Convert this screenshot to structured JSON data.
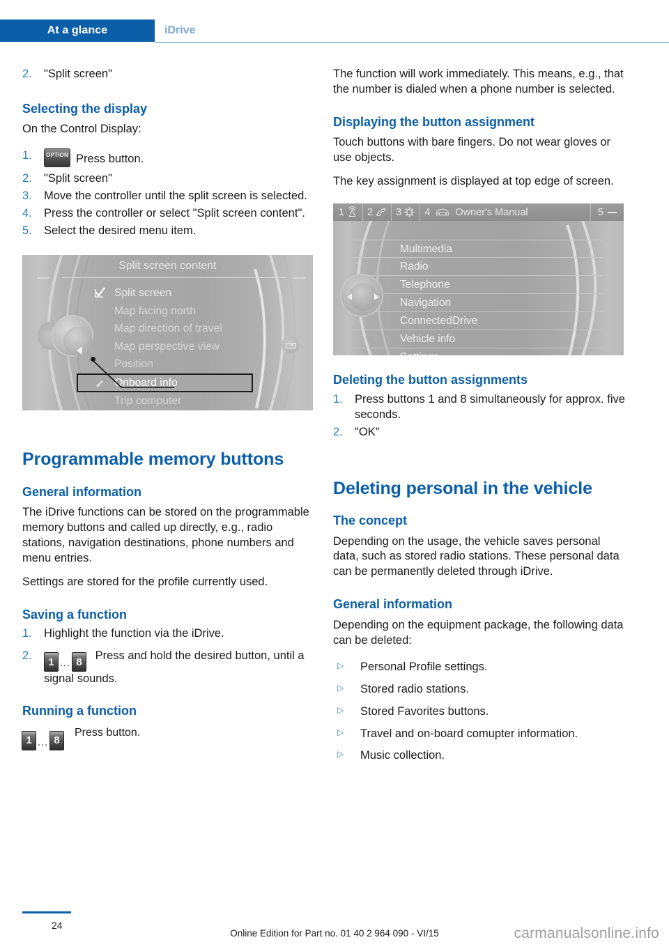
{
  "header": {
    "tab_label": "At a glance",
    "section_label": "iDrive"
  },
  "left_column": {
    "lead_step": {
      "num": "2.",
      "text": "\"Split screen\""
    },
    "heading_selecting": "Selecting the display",
    "intro": "On the Control Display:",
    "steps": [
      {
        "num": "1.",
        "icon": "option-button-icon",
        "icon_label": "OPTION",
        "text": "Press button."
      },
      {
        "num": "2.",
        "text": "\"Split screen\""
      },
      {
        "num": "3.",
        "text": "Move the controller until the split screen is selected."
      },
      {
        "num": "4.",
        "text": "Press the controller or select \"Split screen content\"."
      },
      {
        "num": "5.",
        "text": "Select the desired menu item."
      }
    ],
    "screenshot_split": {
      "title": "Split screen content",
      "items": [
        {
          "label": "Split screen",
          "marker": "checkbox-checked",
          "selected": false
        },
        {
          "label": "Map facing north",
          "marker": "",
          "selected": false
        },
        {
          "label": "Map direction of travel",
          "marker": "",
          "selected": false
        },
        {
          "label": "Map perspective view",
          "marker": "",
          "selected": false
        },
        {
          "label": "Position",
          "marker": "",
          "selected": false
        },
        {
          "label": "Onboard info",
          "marker": "check",
          "selected": true
        },
        {
          "label": "Trip computer",
          "marker": "",
          "selected": false
        }
      ]
    },
    "heading_programmable": "Programmable memory buttons",
    "heading_general_info": "General information",
    "general_info_p1": "The iDrive functions can be stored on the programmable memory buttons and called up directly, e.g., radio stations, navigation destinations, phone numbers and menu entries.",
    "general_info_p2": "Settings are stored for the profile currently used.",
    "heading_saving": "Saving a function",
    "saving_steps": [
      {
        "num": "1.",
        "text": "Highlight the function via the iDrive."
      },
      {
        "num": "2.",
        "btn_from": "1",
        "btn_dots": "…",
        "btn_to": "8",
        "text": "Press and hold the desired button, until a signal sounds."
      }
    ],
    "heading_running": "Running a function",
    "running": {
      "btn_from": "1",
      "btn_dots": "…",
      "btn_to": "8",
      "text": "Press button."
    }
  },
  "right_column": {
    "p_function": "The function will work immediately. This means, e.g., that the number is dialed when a phone number is selected.",
    "heading_displaying": "Displaying the button assignment",
    "p_touch": "Touch buttons with bare fingers. Do not wear gloves or use objects.",
    "p_key": "The key assignment is displayed at top edge of screen.",
    "screenshot_manual": {
      "tabs": [
        {
          "num": "1",
          "icon": "radio-waves-icon"
        },
        {
          "num": "2",
          "icon": "telephone-handset-icon"
        },
        {
          "num": "3",
          "icon": "gear-icon"
        },
        {
          "num": "4",
          "icon": "car-front-icon",
          "label": "Owner's Manual"
        },
        {
          "num": "5",
          "icon": "minus-icon"
        }
      ],
      "items": [
        "Multimedia",
        "Radio",
        "Telephone",
        "Navigation",
        "ConnectedDrive",
        "Vehicle info",
        "Settings"
      ]
    },
    "heading_deleting_buttons": "Deleting the button assignments",
    "deleting_steps": [
      {
        "num": "1.",
        "text": "Press buttons 1 and 8 simultaneously for approx. five seconds."
      },
      {
        "num": "2.",
        "text": "\"OK\""
      }
    ],
    "heading_deleting_personal": "Deleting personal in the vehicle",
    "heading_concept": "The concept",
    "p_concept": "Depending on the usage, the vehicle saves personal data, such as stored radio stations. These personal data can be permanently deleted through iDrive.",
    "heading_general_info2": "General information",
    "p_general2": "Depending on the equipment package, the following data can be deleted:",
    "bullets": [
      "Personal Profile settings.",
      "Stored radio stations.",
      "Stored Favorites buttons.",
      "Travel and on-board comupter information.",
      "Music collection."
    ]
  },
  "footer": {
    "page_number": "24",
    "edition": "Online Edition for Part no. 01 40 2 964 090 - VI/15",
    "watermark": "carmanualsonline.info"
  },
  "colors": {
    "brand_blue": "#0b5ea8",
    "light_blue": "#7ba7d4",
    "step_blue": "#2a7ec0"
  }
}
